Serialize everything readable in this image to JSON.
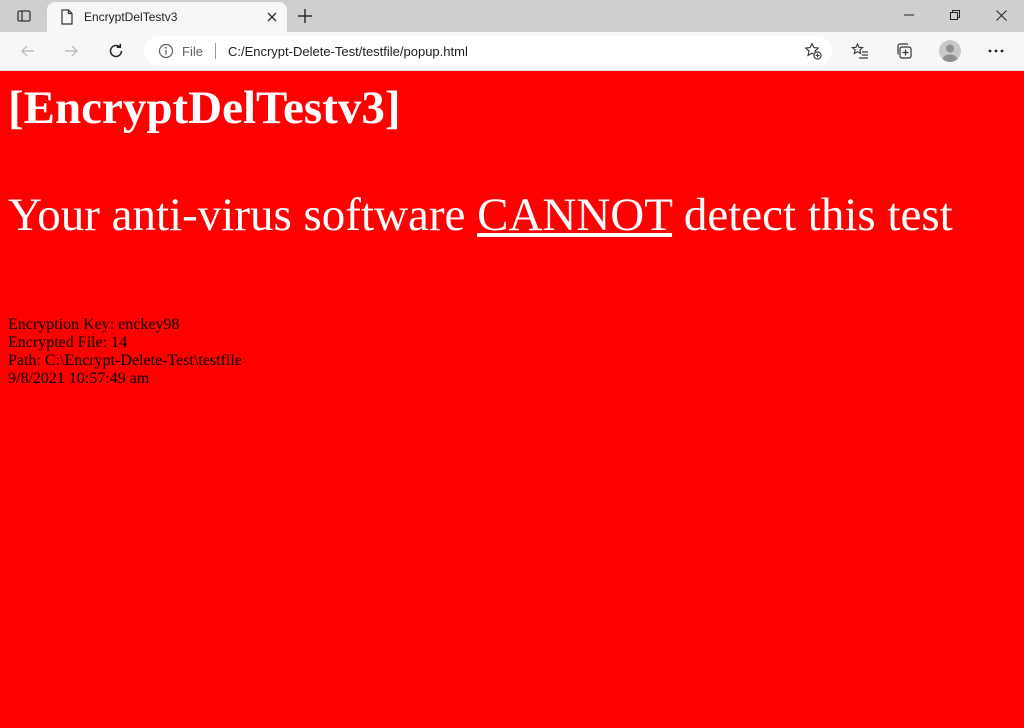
{
  "browser": {
    "tab": {
      "title": "EncryptDelTestv3"
    },
    "address": {
      "scheme_label": "File",
      "url": "C:/Encrypt-Delete-Test/testfile/popup.html"
    }
  },
  "page": {
    "title": "[EncryptDelTestv3]",
    "warning_prefix": "Your anti-virus software ",
    "warning_emphasis": "CANNOT",
    "warning_suffix": " detect this test",
    "details": [
      "Encryption Key: enckey98",
      "Encrypted File: 14",
      "Path: C:\\Encrypt-Delete-Test\\testfile",
      "9/8/2021 10:57:49 am"
    ]
  },
  "colors": {
    "page_background": "#ff0000",
    "heading_text": "#ffffff",
    "details_text": "#000000"
  },
  "icons": {
    "tab_actions": "tab-actions-icon",
    "tab_favicon": "page-icon",
    "tab_close": "close-icon",
    "new_tab": "plus-icon",
    "minimize": "minimize-icon",
    "restore": "restore-icon",
    "close_window": "close-icon",
    "back": "arrow-left-icon",
    "forward": "arrow-right-icon",
    "refresh": "refresh-icon",
    "info": "info-icon",
    "add_favorite": "star-plus-icon",
    "favorites": "favorites-icon",
    "collections": "collections-icon",
    "profile": "profile-icon",
    "more": "more-icon"
  }
}
